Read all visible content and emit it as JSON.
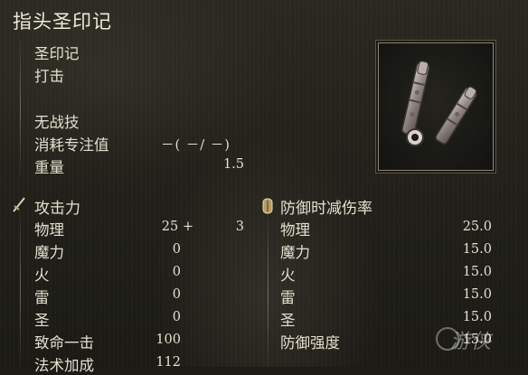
{
  "item": {
    "name": "指头圣印记",
    "category": "圣印记",
    "attack_type": "打击",
    "skill": "无战技",
    "fp_label": "消耗专注值",
    "fp_value": "－(  －/  －)",
    "weight_label": "重量",
    "weight_value": "1.5"
  },
  "attack": {
    "header": "攻击力",
    "rows": [
      {
        "label": "物理",
        "value": "25 +",
        "extra": "3"
      },
      {
        "label": "魔力",
        "value": "0",
        "extra": ""
      },
      {
        "label": "火",
        "value": "0",
        "extra": ""
      },
      {
        "label": "雷",
        "value": "0",
        "extra": ""
      },
      {
        "label": "圣",
        "value": "0",
        "extra": ""
      },
      {
        "label": "致命一击",
        "value": "100",
        "extra": ""
      },
      {
        "label": "法术加成",
        "value": "112",
        "extra": ""
      }
    ]
  },
  "guard": {
    "header": "防御时减伤率",
    "rows": [
      {
        "label": "物理",
        "value": "25.0"
      },
      {
        "label": "魔力",
        "value": "15.0"
      },
      {
        "label": "火",
        "value": "15.0"
      },
      {
        "label": "雷",
        "value": "15.0"
      },
      {
        "label": "圣",
        "value": "15.0"
      },
      {
        "label": "防御强度",
        "value": "15.0"
      }
    ]
  },
  "icons": {
    "attack": "sword-icon",
    "guard": "shield-icon",
    "item": "finger-seal-icon"
  },
  "watermark": "游侠"
}
